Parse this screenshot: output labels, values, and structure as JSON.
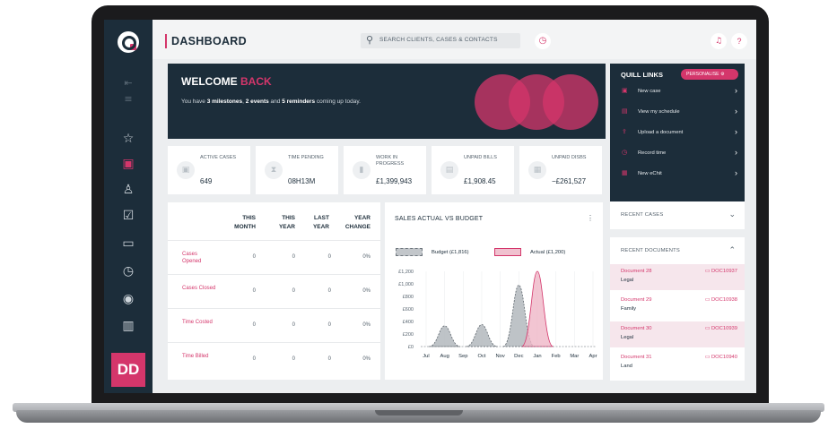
{
  "app": {
    "page_title": "DASHBOARD",
    "search": {
      "placeholder": "SEARCH CLIENTS, CASES & CONTACTS"
    },
    "user_initials": "DD"
  },
  "sidebar": {
    "icons": [
      "collapse-icon",
      "filter-icon",
      "star-icon",
      "briefcase-icon",
      "contacts-icon",
      "calendar-check-icon",
      "folder-icon",
      "stopwatch-icon",
      "eye-icon",
      "reports-icon"
    ]
  },
  "welcome": {
    "title_main": "WELCOME",
    "title_accent": "BACK",
    "sub_prefix": "You have ",
    "sub_milestones": "3 milestones",
    "sub_sep1": ", ",
    "sub_events": "2 events",
    "sub_sep2": " and ",
    "sub_reminders": "5 reminders",
    "sub_suffix": " coming up today."
  },
  "stats": [
    {
      "label": "ACTIVE CASES",
      "value": "649",
      "icon": "briefcase-icon"
    },
    {
      "label": "TIME PENDING",
      "value": "08H13M",
      "icon": "hourglass-icon"
    },
    {
      "label": "WORK IN PROGRESS",
      "value": "£1,399,943",
      "icon": "chart-icon"
    },
    {
      "label": "UNPAID BILLS",
      "value": "£1,908.45",
      "icon": "bill-icon"
    },
    {
      "label": "UNPAID DISBS",
      "value": "−£261,527",
      "icon": "calculator-icon"
    }
  ],
  "summary_table": {
    "headers": [
      "THIS MONTH",
      "THIS YEAR",
      "LAST YEAR",
      "YEAR CHANGE"
    ],
    "rows": [
      {
        "label": "Cases Opened",
        "values": [
          "0",
          "0",
          "0",
          "0%"
        ]
      },
      {
        "label": "Cases Closed",
        "values": [
          "0",
          "0",
          "0",
          "0%"
        ]
      },
      {
        "label": "Time Costed",
        "values": [
          "0",
          "0",
          "0",
          "0%"
        ]
      },
      {
        "label": "Time Billed",
        "values": [
          "0",
          "0",
          "0",
          "0%"
        ]
      }
    ]
  },
  "sales_chart": {
    "title": "SALES ACTUAL VS BUDGET",
    "legend_budget": "Budget (£1,816)",
    "legend_actual": "Actual (£1,200)",
    "colors": {
      "budget": "#9aa0a6",
      "actual": "#e8a1b7"
    }
  },
  "chart_data": {
    "type": "area",
    "title": "SALES ACTUAL VS BUDGET",
    "categories": [
      "Jul",
      "Aug",
      "Sep",
      "Oct",
      "Nov",
      "Dec",
      "Jan",
      "Feb",
      "Mar",
      "Apr"
    ],
    "y_ticks": [
      "£1,200",
      "£1,000",
      "£800",
      "£600",
      "£400",
      "£200",
      "£0"
    ],
    "ylim": [
      0,
      1200
    ],
    "series": [
      {
        "name": "Budget (£1,816)",
        "values": [
          0,
          330,
          0,
          350,
          0,
          980,
          0,
          0,
          0,
          0
        ]
      },
      {
        "name": "Actual (£1,200)",
        "values": [
          0,
          0,
          0,
          0,
          0,
          0,
          1200,
          0,
          0,
          0
        ]
      }
    ]
  },
  "quill_links": {
    "title": "QUILL LINKS",
    "personalise": "PERSONALISE",
    "items": [
      {
        "label": "New case",
        "icon": "camera-icon"
      },
      {
        "label": "View my schedule",
        "icon": "calendar-icon"
      },
      {
        "label": "Upload a document",
        "icon": "upload-icon"
      },
      {
        "label": "Record time",
        "icon": "stopwatch-icon"
      },
      {
        "label": "New eChit",
        "icon": "echit-icon"
      }
    ]
  },
  "recent_cases": {
    "title": "RECENT CASES"
  },
  "recent_documents": {
    "title": "RECENT DOCUMENTS",
    "items": [
      {
        "name": "Document 28",
        "type": "Legal",
        "ref": "DOC10937"
      },
      {
        "name": "Document 29",
        "type": "Family",
        "ref": "DOC10938"
      },
      {
        "name": "Document 30",
        "type": "Legal",
        "ref": "DOC10939"
      },
      {
        "name": "Document 31",
        "type": "Land",
        "ref": "DOC10940"
      }
    ]
  }
}
